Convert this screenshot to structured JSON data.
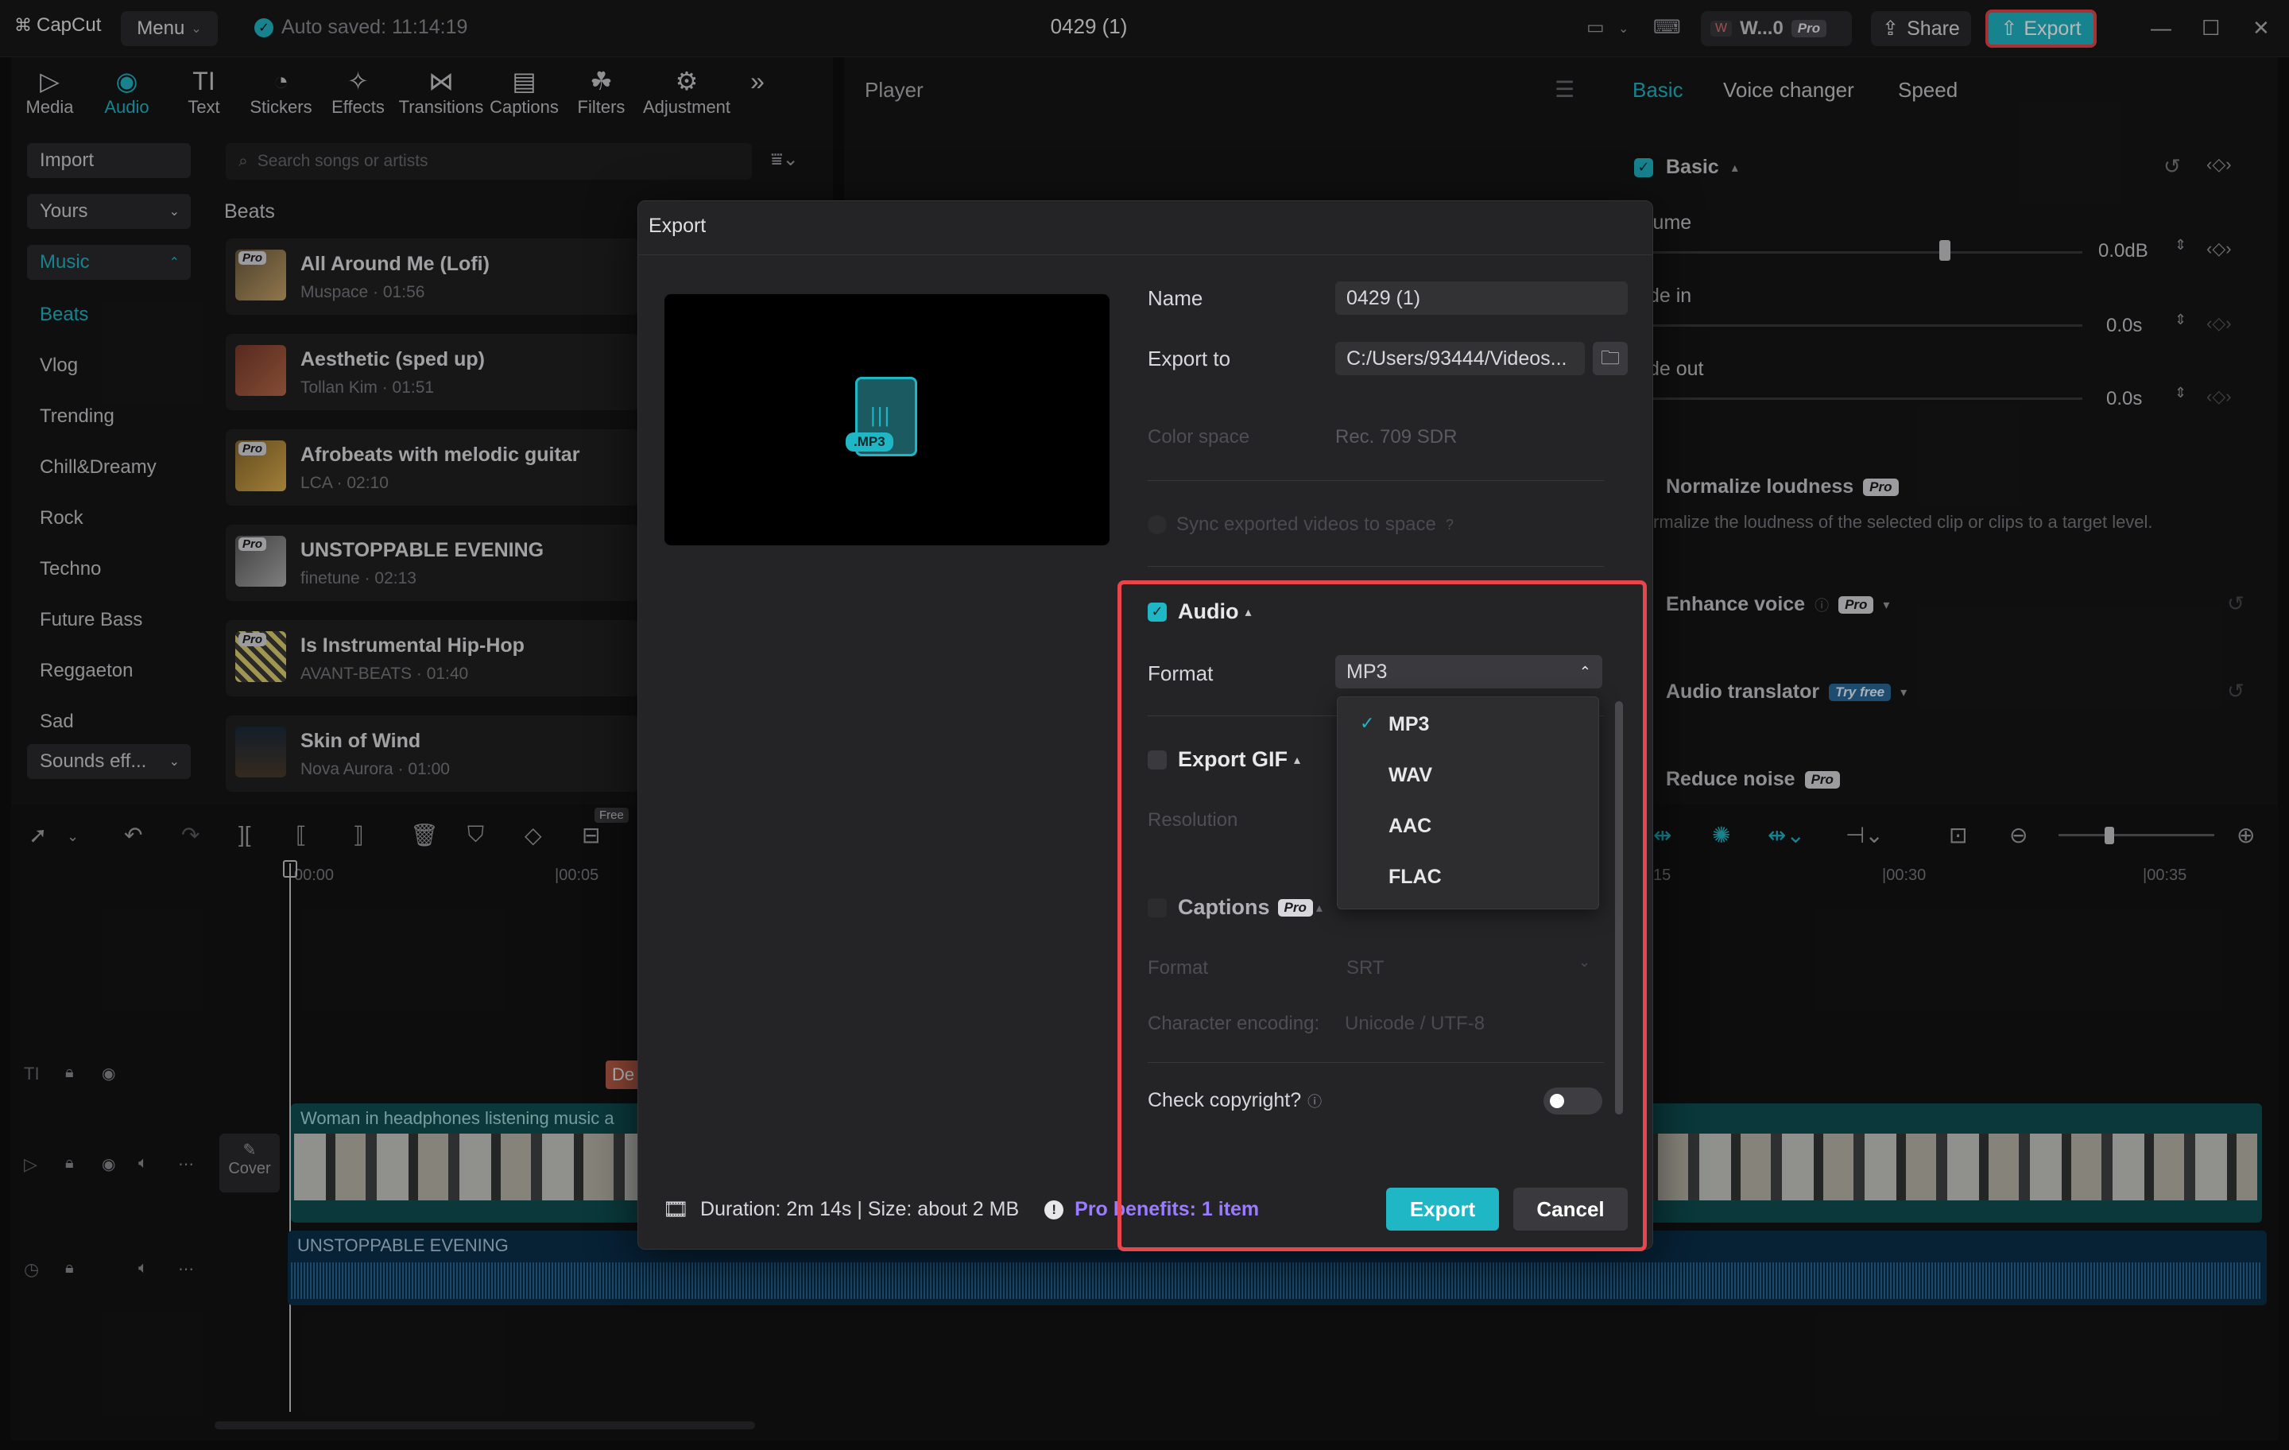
{
  "titlebar": {
    "app_name": "CapCut",
    "menu_label": "Menu",
    "autosave_text": "Auto saved: 11:14:19",
    "project_title": "0429 (1)",
    "workspace_label": "W...0",
    "pro_badge": "Pro",
    "share_label": "Share",
    "export_label": "Export"
  },
  "toolbar": {
    "tabs": [
      {
        "label": "Media",
        "icon": "media-icon"
      },
      {
        "label": "Audio",
        "icon": "audio-icon"
      },
      {
        "label": "Text",
        "icon": "text-icon"
      },
      {
        "label": "Stickers",
        "icon": "stickers-icon"
      },
      {
        "label": "Effects",
        "icon": "effects-icon"
      },
      {
        "label": "Transitions",
        "icon": "transitions-icon"
      },
      {
        "label": "Captions",
        "icon": "captions-icon"
      },
      {
        "label": "Filters",
        "icon": "filters-icon"
      },
      {
        "label": "Adjustment",
        "icon": "adjustment-icon"
      }
    ],
    "active_tab": "Audio"
  },
  "sidebar": {
    "import_label": "Import",
    "yours_label": "Yours",
    "music_label": "Music",
    "categories": [
      "Beats",
      "Vlog",
      "Trending",
      "Chill&Dreamy",
      "Rock",
      "Techno",
      "Future Bass",
      "Reggaeton",
      "Sad"
    ],
    "sounds_label": "Sounds eff..."
  },
  "library": {
    "search_placeholder": "Search songs or artists",
    "section_title": "Beats",
    "pro_badge": "Pro",
    "songs": [
      {
        "title": "All Around Me (Lofi)",
        "meta": "Muspace · 01:56"
      },
      {
        "title": "Aesthetic (sped up)",
        "meta": "Tollan Kim · 01:51"
      },
      {
        "title": "Afrobeats with melodic guitar",
        "meta": "LCA · 02:10"
      },
      {
        "title": "UNSTOPPABLE EVENING",
        "meta": "finetune · 02:13"
      },
      {
        "title": "Is Instrumental Hip-Hop",
        "meta": "AVANT-BEATS · 01:40"
      },
      {
        "title": "Skin of Wind",
        "meta": "Nova Aurora · 01:00"
      }
    ]
  },
  "player": {
    "title": "Player"
  },
  "right_panel": {
    "tabs": [
      "Basic",
      "Voice changer",
      "Speed"
    ],
    "basic_label": "Basic",
    "volume_label": "lume",
    "volume_value": "0.0dB",
    "fade_in_label": "de in",
    "fade_in_value": "0.0s",
    "fade_out_label": "de out",
    "fade_out_value": "0.0s",
    "normalize_title": "Normalize loudness",
    "normalize_desc": "rmalize the loudness of the selected clip or clips to a target level.",
    "enhance_voice": "Enhance voice",
    "audio_translator": "Audio translator",
    "try_free": "Try free",
    "reduce_noise": "Reduce noise",
    "pro_badge": "Pro"
  },
  "timeline": {
    "ruler_start": "00:00",
    "ruler_05": "|00:05",
    "ruler_30": "|00:30",
    "ruler_35": "|00:35",
    "ruler_partial": "15",
    "free_badge": "Free",
    "cover_label": "Cover",
    "video_clip_label": "Woman in headphones listening music a",
    "audio_clip_label": "UNSTOPPABLE EVENING",
    "text_clip_partial": "De"
  },
  "export_dialog": {
    "title": "Export",
    "file_badge": ".MP3",
    "name_label": "Name",
    "name_value": "0429 (1)",
    "export_to_label": "Export to",
    "export_to_value": "C:/Users/93444/Videos...",
    "color_space_label": "Color space",
    "color_space_value": "Rec. 709 SDR",
    "sync_label": "Sync exported videos to space",
    "audio_section": "Audio",
    "format_label": "Format",
    "format_value": "MP3",
    "format_options": [
      "MP3",
      "WAV",
      "AAC",
      "FLAC"
    ],
    "export_gif_label": "Export GIF",
    "resolution_label": "Resolution",
    "captions_label": "Captions",
    "captions_pro": "Pro",
    "captions_format_label": "Format",
    "captions_format_value": "SRT",
    "char_encoding_label": "Character encoding:",
    "char_encoding_value": "Unicode / UTF-8",
    "copyright_label": "Check copyright?",
    "copyright_enabled": false,
    "duration_info": "Duration: 2m 14s | Size: about 2 MB",
    "pro_benefits": "Pro benefits: 1 item",
    "export_button": "Export",
    "cancel_button": "Cancel"
  },
  "colors": {
    "accent": "#1fb6c6",
    "highlight_border": "#e8464a",
    "pro_purple": "#9b7bff"
  }
}
